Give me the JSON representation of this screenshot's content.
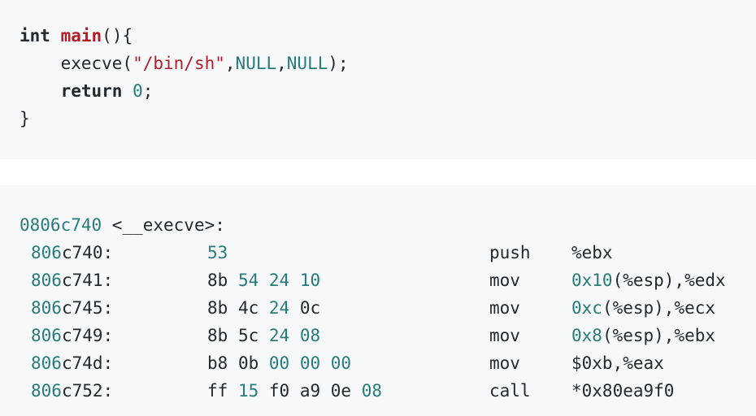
{
  "c_code": {
    "line1": {
      "kw": "int",
      "fn": "main",
      "rest": "(){"
    },
    "line2": {
      "indent": "    ",
      "call": "execve(",
      "str": "\"/bin/sh\"",
      "comma1": ",",
      "arg1": "NULL",
      "comma2": ",",
      "arg2": "NULL",
      "end": ");"
    },
    "line3": {
      "indent": "    ",
      "kw": "return",
      "space": " ",
      "num": "0",
      "end": ";"
    },
    "line4": {
      "text": "}"
    }
  },
  "disassembly": {
    "header": {
      "addr": "0806c740",
      "label": " <__execve>:"
    },
    "rows": [
      {
        "addr_hex": "806",
        "addr_rest": "c740:",
        "bytes": [
          {
            "t": "53",
            "hl": true
          }
        ],
        "mnemonic": "push",
        "operands": [
          {
            "t": "%ebx",
            "hl": false
          }
        ]
      },
      {
        "addr_hex": "806",
        "addr_rest": "c741:",
        "bytes": [
          {
            "t": "8b",
            "hl": false
          },
          {
            "t": "54",
            "hl": true
          },
          {
            "t": "24",
            "hl": true
          },
          {
            "t": "10",
            "hl": true
          }
        ],
        "mnemonic": "mov",
        "operands": [
          {
            "t": "0x10",
            "hl": true
          },
          {
            "t": "(%esp),%edx",
            "hl": false
          }
        ]
      },
      {
        "addr_hex": "806",
        "addr_rest": "c745:",
        "bytes": [
          {
            "t": "8b",
            "hl": false
          },
          {
            "t": "4c",
            "hl": false
          },
          {
            "t": "24",
            "hl": true
          },
          {
            "t": "0c",
            "hl": false
          }
        ],
        "mnemonic": "mov",
        "operands": [
          {
            "t": "0xc",
            "hl": true
          },
          {
            "t": "(%esp),%ecx",
            "hl": false
          }
        ]
      },
      {
        "addr_hex": "806",
        "addr_rest": "c749:",
        "bytes": [
          {
            "t": "8b",
            "hl": false
          },
          {
            "t": "5c",
            "hl": false
          },
          {
            "t": "24",
            "hl": true
          },
          {
            "t": "08",
            "hl": true
          }
        ],
        "mnemonic": "mov",
        "operands": [
          {
            "t": "0x8",
            "hl": true
          },
          {
            "t": "(%esp),%ebx",
            "hl": false
          }
        ]
      },
      {
        "addr_hex": "806",
        "addr_rest": "c74d:",
        "bytes": [
          {
            "t": "b8",
            "hl": false
          },
          {
            "t": "0b",
            "hl": false
          },
          {
            "t": "00",
            "hl": true
          },
          {
            "t": "00",
            "hl": true
          },
          {
            "t": "00",
            "hl": true
          }
        ],
        "mnemonic": "mov",
        "operands": [
          {
            "t": "$0xb,%eax",
            "hl": false
          }
        ]
      },
      {
        "addr_hex": "806",
        "addr_rest": "c752:",
        "bytes": [
          {
            "t": "ff",
            "hl": false
          },
          {
            "t": "15",
            "hl": true
          },
          {
            "t": "f0",
            "hl": false
          },
          {
            "t": "a9",
            "hl": false
          },
          {
            "t": "0e",
            "hl": false
          },
          {
            "t": "08",
            "hl": true
          }
        ],
        "mnemonic": "call",
        "operands": [
          {
            "t": "*0x80ea9f0",
            "hl": false
          }
        ]
      }
    ]
  },
  "colors": {
    "background": "#ffffff",
    "code_background": "#f6f8fa",
    "text": "#24292e",
    "keyword_fn": "#b31d28",
    "number": "#287b7b"
  }
}
